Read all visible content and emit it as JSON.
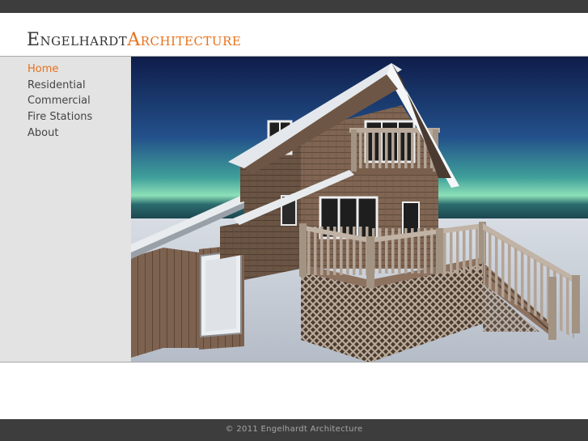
{
  "logo": {
    "first": "Engelhardt",
    "second": "Architecture"
  },
  "nav": {
    "items": [
      {
        "label": "Home",
        "active": true
      },
      {
        "label": "Residential",
        "active": false
      },
      {
        "label": "Commercial",
        "active": false
      },
      {
        "label": "Fire Stations",
        "active": false
      },
      {
        "label": "About",
        "active": false
      }
    ]
  },
  "hero": {
    "image": "house-rendering"
  },
  "footer": {
    "text": "© 2011 Engelhardt Architecture"
  },
  "colors": {
    "accent": "#e8711a",
    "bar": "#3d3d3d",
    "sidebar": "#e3e3e3"
  }
}
